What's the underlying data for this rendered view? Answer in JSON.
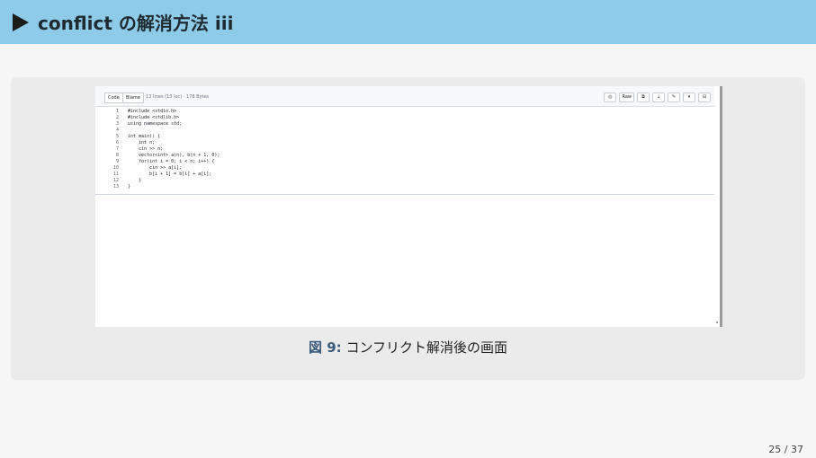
{
  "header": {
    "title": "conflict の解消方法  iii"
  },
  "editor": {
    "tabs": [
      {
        "label": "Code"
      },
      {
        "label": "Blame"
      }
    ],
    "file_info": "13 lines (13 loc) · 178 Bytes",
    "toolbar_buttons": [
      "Raw",
      "copy-icon",
      "download-icon",
      "edit-icon",
      "more-icon",
      "panel-icon"
    ],
    "code_lines": [
      {
        "ln": "1",
        "text": "#include <stdio.h>"
      },
      {
        "ln": "2",
        "text": "#include <stdlib.h>"
      },
      {
        "ln": "3",
        "text": "using namespace std;"
      },
      {
        "ln": "4",
        "text": ""
      },
      {
        "ln": "5",
        "text": "int main() {"
      },
      {
        "ln": "6",
        "text": "    int n;"
      },
      {
        "ln": "7",
        "text": "    cin >> n;"
      },
      {
        "ln": "8",
        "text": "    vector<int> a(n), b(n + 1, 0);"
      },
      {
        "ln": "9",
        "text": "    for(int i = 0; i < n; i++) {"
      },
      {
        "ln": "10",
        "text": "        cin >> a[i];"
      },
      {
        "ln": "11",
        "text": "        b[i + 1] = b[i] + a[i];"
      },
      {
        "ln": "12",
        "text": "    }"
      },
      {
        "ln": "13",
        "text": "}"
      }
    ]
  },
  "figure": {
    "label": "図 9:",
    "caption": "コンフリクト解消後の画面"
  },
  "page": {
    "number": "25 / 37"
  }
}
